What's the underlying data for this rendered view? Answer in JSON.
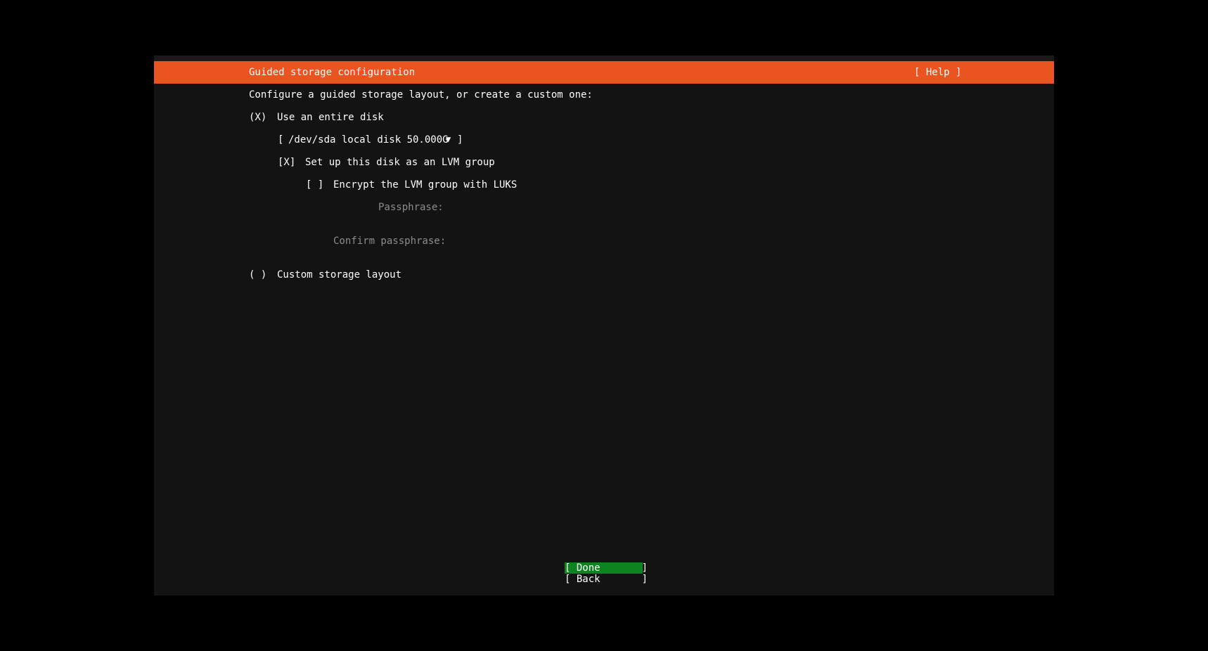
{
  "header": {
    "title": "Guided storage configuration",
    "help_label": "[ Help ]"
  },
  "intro": "Configure a guided storage layout, or create a custom one:",
  "option_entire_disk": {
    "radio": "(X)",
    "label": "Use an entire disk"
  },
  "disk_select": {
    "open_bracket": "[",
    "value": "/dev/sda local disk 50.000G",
    "arrow": "▼",
    "close_bracket": "]"
  },
  "lvm": {
    "checkbox": "[X]",
    "label": "Set up this disk as an LVM group"
  },
  "luks": {
    "checkbox": "[ ]",
    "label": "Encrypt the LVM group with LUKS"
  },
  "passphrase_label": "Passphrase:",
  "confirm_passphrase_label": "Confirm passphrase:",
  "option_custom": {
    "radio": "( )",
    "label": "Custom storage layout"
  },
  "buttons": {
    "done": "[ Done       ]",
    "back": "[ Back       ]"
  },
  "colors": {
    "header_bg": "#e95420",
    "done_bg": "#0e8420",
    "screen_bg": "#131313",
    "dim_text": "#8c8c8c"
  }
}
